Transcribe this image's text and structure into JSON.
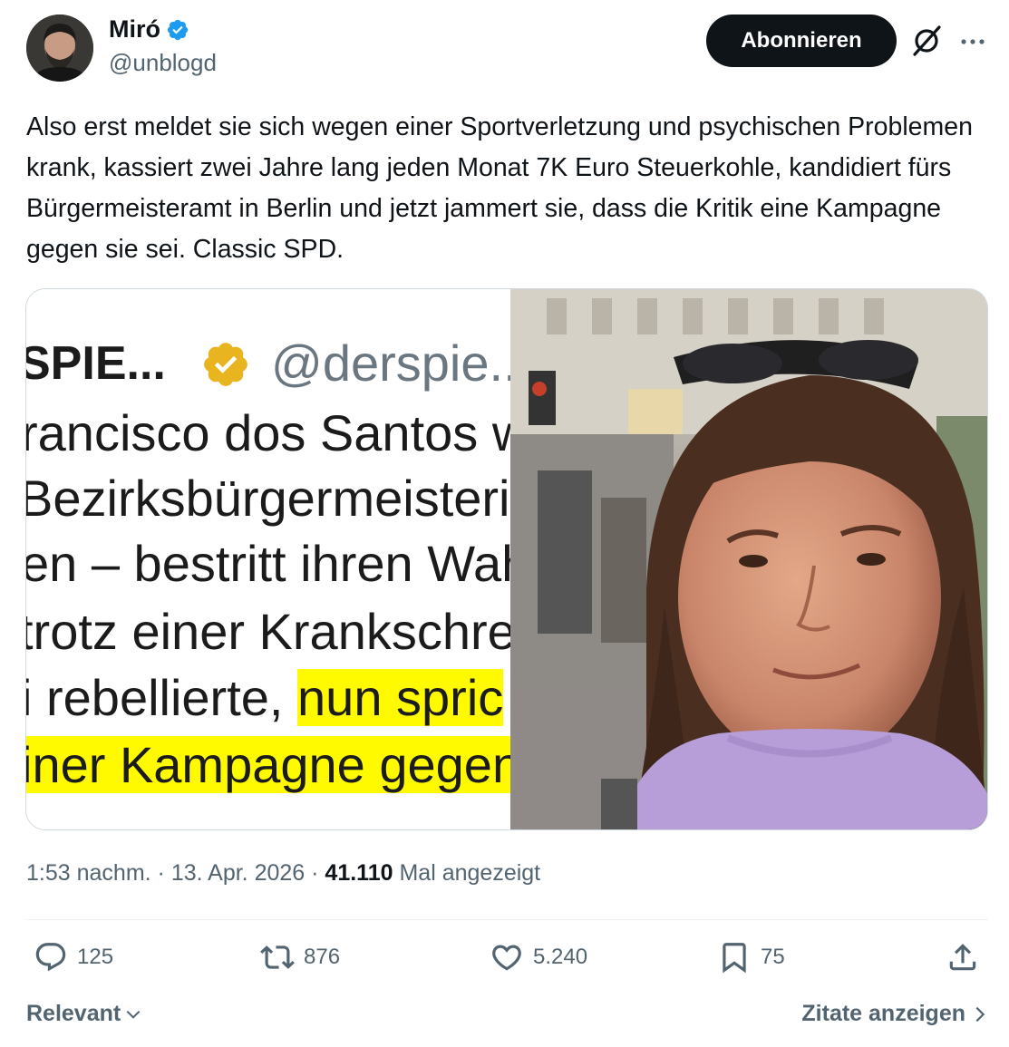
{
  "author": {
    "display_name": "Miró",
    "handle": "@unblogd",
    "verified": true
  },
  "header": {
    "subscribe_label": "Abonnieren",
    "grok_icon": "grok-icon",
    "more_icon": "more-icon"
  },
  "tweet": {
    "text": "Also erst meldet sie sich wegen einer Sportverletzung und psychischen Problemen krank, kassiert zwei Jahre lang jeden Monat 7K Euro Steuerkohle, kandidiert fürs Bürgermeisteramt in Berlin und jetzt jammert sie, dass die Kritik eine Kampagne gegen sie sei. Classic SPD."
  },
  "media": {
    "screenshot_source_name": "SPIE...",
    "screenshot_source_handle": "@derspie...",
    "screenshot_lines": [
      "rancisco dos Santos w",
      "Bezirksbürgermeisteri",
      "en – bestritt ihren Wah",
      "trotz einer Krankschre",
      "i rebellierte, ",
      "iner Kampagne gegen"
    ],
    "screenshot_highlight": "nun spric"
  },
  "meta": {
    "time": "1:53 nachm.",
    "date": "13. Apr. 2026",
    "views_count": "41.110",
    "views_label": "Mal angezeigt"
  },
  "actions": {
    "replies": "125",
    "reposts": "876",
    "likes": "5.240",
    "bookmarks": "75"
  },
  "footer": {
    "sort_label": "Relevant",
    "quotes_label": "Zitate anzeigen"
  },
  "colors": {
    "verified_badge": "#1d9bf0",
    "muted_text": "#536471",
    "primary_text": "#0f1419",
    "highlight": "#fffa00"
  }
}
